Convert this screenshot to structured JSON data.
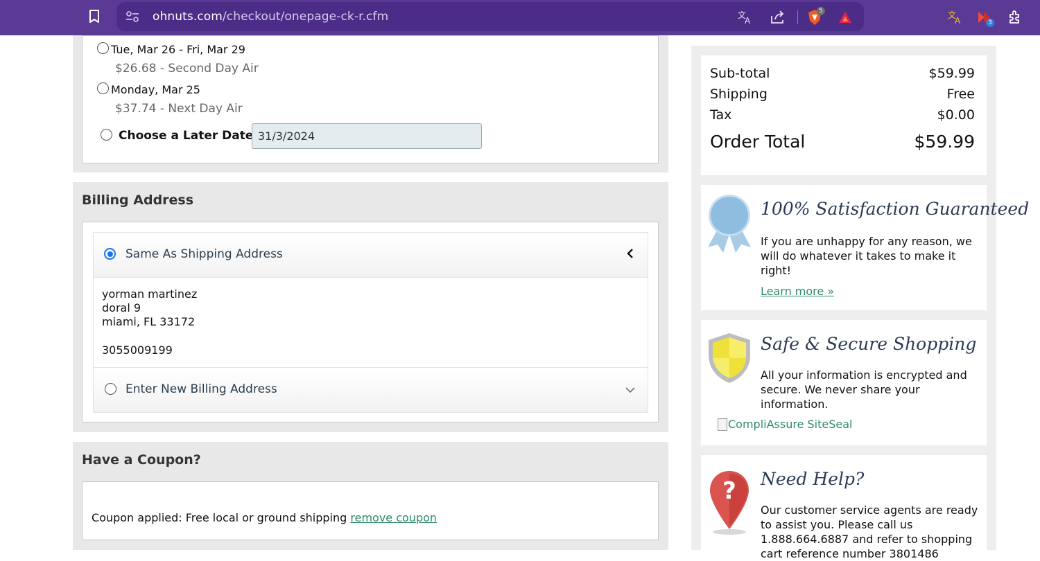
{
  "browser": {
    "url_domain": "ohnuts.com",
    "url_path": "/checkout/onepage-ck-r.cfm",
    "brave_badge": "5",
    "ext_badge": "3",
    "icons": [
      "bookmark-icon",
      "site-settings-icon",
      "translate-icon",
      "share-icon",
      "brave-shields-icon",
      "brave-rewards-icon",
      "translate-extension-icon",
      "media-extension-icon",
      "extensions-puzzle-icon"
    ],
    "colors": {
      "bar": "#5b3a96",
      "url_box": "#4b2c86"
    }
  },
  "shipping": {
    "options": [
      {
        "date": "Tue, Mar 26 - Fri, Mar 29",
        "price": "$26.68 - Second Day Air",
        "selected": false
      },
      {
        "date": "Monday, Mar 25",
        "price": "$37.74 - Next Day Air",
        "selected": false
      }
    ],
    "later_label": "Choose a Later Date:",
    "later_value": "31/3/2024"
  },
  "billing": {
    "title": "Billing Address",
    "same_label": "Same As Shipping Address",
    "address": {
      "name": "yorman martinez",
      "street": "doral 9",
      "city_line": "miami, FL 33172",
      "phone": "3055009199"
    },
    "new_label": "Enter New Billing Address"
  },
  "coupon": {
    "title": "Have a Coupon?",
    "applied_text": "Coupon applied: Free local or ground shipping",
    "remove_link": "remove coupon"
  },
  "summary": {
    "subtotal_label": "Sub-total",
    "subtotal_value": "$59.99",
    "shipping_label": "Shipping",
    "shipping_value": "Free",
    "tax_label": "Tax",
    "tax_value": "$0.00",
    "total_label": "Order Total",
    "total_value": "$59.99"
  },
  "satisfaction": {
    "title": "100% Satisfaction Guaranteed",
    "text": "If you are unhappy for any reason, we will do whatever it takes to make it right!",
    "link": "Learn more »"
  },
  "secure": {
    "title": "Safe & Secure Shopping",
    "text": "All your information is encrypted and secure. We never share your information.",
    "seal_alt": "CompliAssure SiteSeal"
  },
  "help": {
    "title": "Need Help?",
    "text": "Our customer service agents are ready to assist you. Please call us 1.888.664.6887 and refer to shopping cart reference number 3801486"
  }
}
